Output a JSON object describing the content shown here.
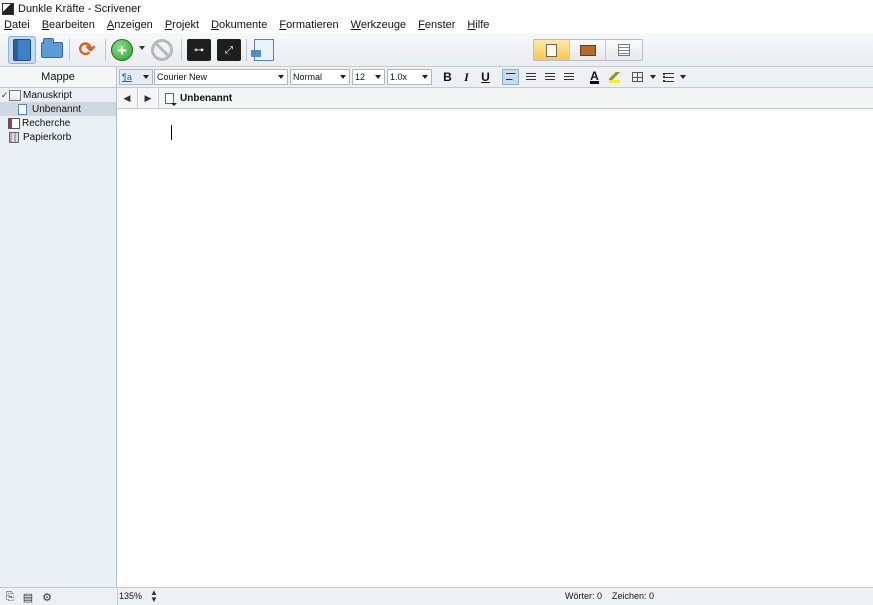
{
  "window": {
    "title": "Dunkle Kräfte - Scrivener"
  },
  "menu": [
    "Datei",
    "Bearbeiten",
    "Anzeigen",
    "Projekt",
    "Dokumente",
    "Formatieren",
    "Werkzeuge",
    "Fenster",
    "Hilfe"
  ],
  "binder": {
    "header": "Mappe",
    "items": [
      {
        "label": "Manuskript"
      },
      {
        "label": "Unbenannt"
      },
      {
        "label": "Recherche"
      },
      {
        "label": "Papierkorb"
      }
    ]
  },
  "format": {
    "font": "Courier New",
    "style": "Normal",
    "size": "12",
    "spacing": "1.0x",
    "bold": "B",
    "italic": "I",
    "underline": "U",
    "text_color": "A"
  },
  "header": {
    "doc_title": "Unbenannt"
  },
  "footer": {
    "zoom": "135%",
    "words": "Wörter: 0",
    "chars": "Zeichen: 0"
  },
  "colors": {
    "accent": "#f5c94f",
    "selection": "#cfd7e0",
    "toolbar_active": "#c7dcf2"
  }
}
